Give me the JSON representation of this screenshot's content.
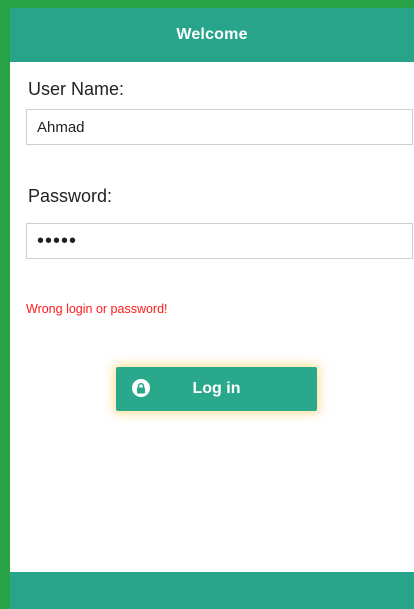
{
  "header": {
    "title": "Welcome"
  },
  "form": {
    "username_label": "User Name:",
    "username_value": "Ahmad",
    "password_label": "Password:",
    "password_value": "•••••",
    "error_message": "Wrong login or password!",
    "login_button_label": "Log in",
    "login_button_icon": "lock-icon"
  },
  "colors": {
    "frame_green": "#27a244",
    "header_teal": "#27a48a",
    "button_teal": "#2aa88b",
    "error_red": "#ff1a1a"
  }
}
